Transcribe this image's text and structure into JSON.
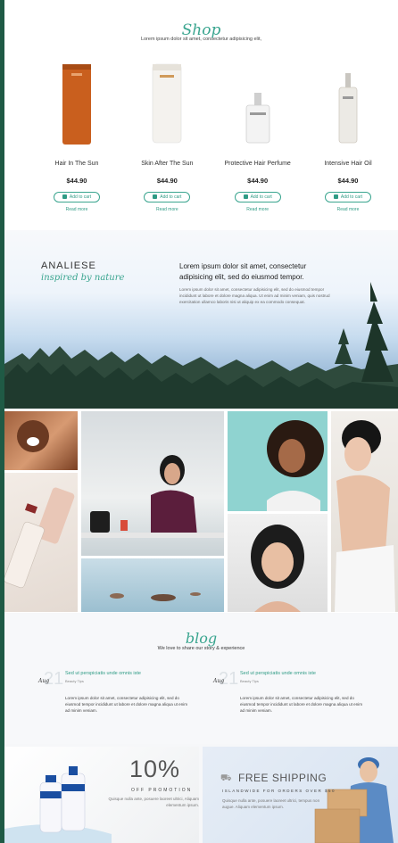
{
  "shop": {
    "title": "Shop",
    "subtitle": "Lorem ipsum dolor sit amet, consectetur adipisicing elit,",
    "products": [
      {
        "name": "Hair In The Sun",
        "price": "$44.90",
        "cart": "Add to cart",
        "more": "Read more"
      },
      {
        "name": "Skin After The Sun",
        "price": "$44.90",
        "cart": "Add to cart",
        "more": "Read more"
      },
      {
        "name": "Protective Hair Perfume",
        "price": "$44.90",
        "cart": "Add to cart",
        "more": "Read more"
      },
      {
        "name": "Intensive Hair Oil",
        "price": "$44.90",
        "cart": "Add to cart",
        "more": "Read more"
      }
    ]
  },
  "hero": {
    "brand": "ANALIESE",
    "tagline": "inspired by nature",
    "heading": "Lorem ipsum dolor sit amet, consectetur adipisicing elit, sed do eiusmod tempor.",
    "body": "Lorem ipsum dolor sit amet, consectetur adipisicing elit, sed do eiusmod tempor incididunt ut labore et dolore magna aliqua. Ut enim ad minim veniam, quis nostrud exercitation ullamco laboris nisi ut aliquip ex ea commodo consequat."
  },
  "blog": {
    "title": "blog",
    "subtitle": "We love to share our story & experience",
    "posts": [
      {
        "day": "21",
        "month": "Aug",
        "title": "Sed ut perspiciatis unde omnis iste",
        "category": "Beauty Tips",
        "body": "Lorem ipsum dolor sit amet, consectetur adipisicing elit, sed do eiusmod tempor incididunt ut labore et dolore magna aliqua ut enim ad minim veniam."
      },
      {
        "day": "21",
        "month": "Aug",
        "title": "Sed ut perspiciatis unde omnis iste",
        "category": "Beauty Tips",
        "body": "Lorem ipsum dolor sit amet, consectetur adipisicing elit, sed do eiusmod tempor incididunt ut labore et dolore magna aliqua ut enim ad minim veniam."
      }
    ]
  },
  "promos": {
    "discount": {
      "big": "10%",
      "label": "OFF PROMOTION",
      "text": "Quisque nulla ante, posuere laoreet ultrici, Aliquam elementum ipsum."
    },
    "shipping": {
      "big": "FREE SHIPPING",
      "label": "ISLANDWIDE FOR ORDERS OVER $50",
      "text": "Quisque nulla ante, posuere laoreet ultrici, tempus non augue. Aliquam elementum ipsum."
    }
  },
  "colors": {
    "accent": "#2f9b85",
    "edge": "#1f5a45"
  }
}
